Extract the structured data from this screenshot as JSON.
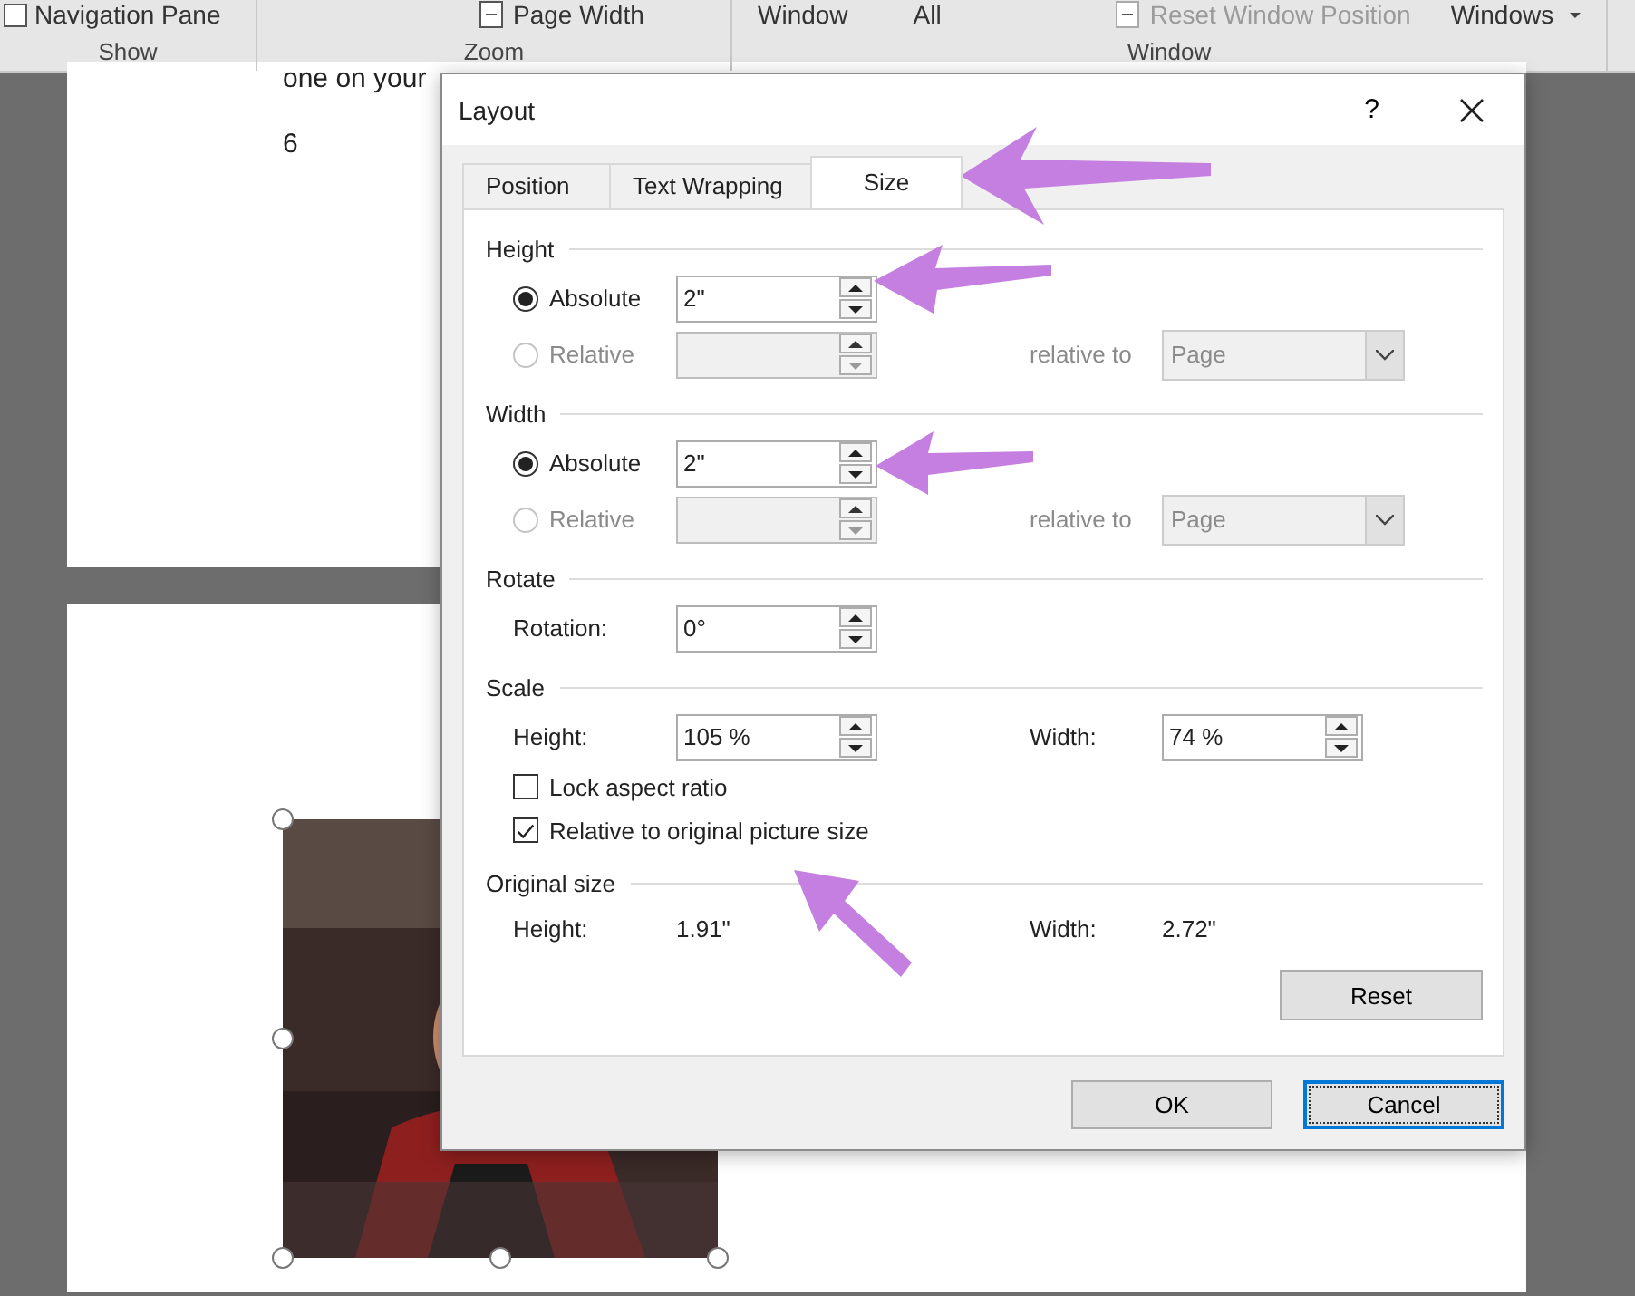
{
  "ribbon": {
    "groups": [
      {
        "label": "Show",
        "items": [
          {
            "kind": "checkbox",
            "label": "Navigation Pane",
            "checked": false,
            "disabled": false
          }
        ]
      },
      {
        "label": "Zoom",
        "items": [
          {
            "kind": "icon",
            "label": "Page Width",
            "disabled": false
          }
        ]
      },
      {
        "label": "Window",
        "items": [
          {
            "kind": "text",
            "label": "Window",
            "disabled": false
          },
          {
            "kind": "text",
            "label": "All",
            "disabled": false
          },
          {
            "kind": "icon",
            "label": "Reset Window Position",
            "disabled": true
          },
          {
            "kind": "menu",
            "label": "Windows",
            "disabled": false
          }
        ]
      }
    ]
  },
  "document": {
    "lines": [
      "one on your",
      "6"
    ],
    "image": {
      "kind": "picture",
      "selected": true
    }
  },
  "dialog": {
    "title": "Layout",
    "help": "?",
    "tabs": [
      {
        "label": "Position",
        "selected": false
      },
      {
        "label": "Text Wrapping",
        "selected": false
      },
      {
        "label": "Size",
        "selected": true
      }
    ],
    "sections": [
      {
        "title": "Height",
        "rows": [
          {
            "kind": "radio",
            "label": "Absolute",
            "selected": true,
            "disabled": false,
            "value": "2\""
          },
          {
            "kind": "radio",
            "label": "Relative",
            "selected": false,
            "disabled": true,
            "extra": {
              "kind": "dropdown",
              "label": "relative to",
              "value": "Page"
            }
          }
        ]
      },
      {
        "title": "Width",
        "rows": [
          {
            "kind": "radio",
            "label": "Absolute",
            "selected": true,
            "disabled": false,
            "value": "2\""
          },
          {
            "kind": "radio",
            "label": "Relative",
            "selected": false,
            "disabled": true,
            "extra": {
              "kind": "dropdown",
              "label": "relative to",
              "value": "Page"
            }
          }
        ]
      },
      {
        "title": "Rotate",
        "rows": [
          {
            "kind": "spin",
            "label": "Rotation:",
            "value": "0°"
          }
        ]
      },
      {
        "title": "Scale",
        "rows": [
          {
            "kind": "spin",
            "label": "Height:",
            "value": "105 %",
            "extra": {
              "kind": "spinner",
              "label": "Width:",
              "value": "74 %"
            }
          },
          {
            "kind": "checkbox",
            "label": "Lock aspect ratio",
            "checked": false
          },
          {
            "kind": "checkbox",
            "label": "Relative to original picture size",
            "checked": true
          }
        ]
      },
      {
        "title": "Original size",
        "rows": [
          {
            "kind": "info",
            "label": "Height:",
            "value": "1.91\"",
            "extra": {
              "kind": "info",
              "label": "Width:",
              "value": "2.72\""
            }
          }
        ]
      }
    ],
    "reset": "Reset",
    "buttons": [
      {
        "label": "OK",
        "default": false
      },
      {
        "label": "Cancel",
        "default": true
      }
    ]
  }
}
